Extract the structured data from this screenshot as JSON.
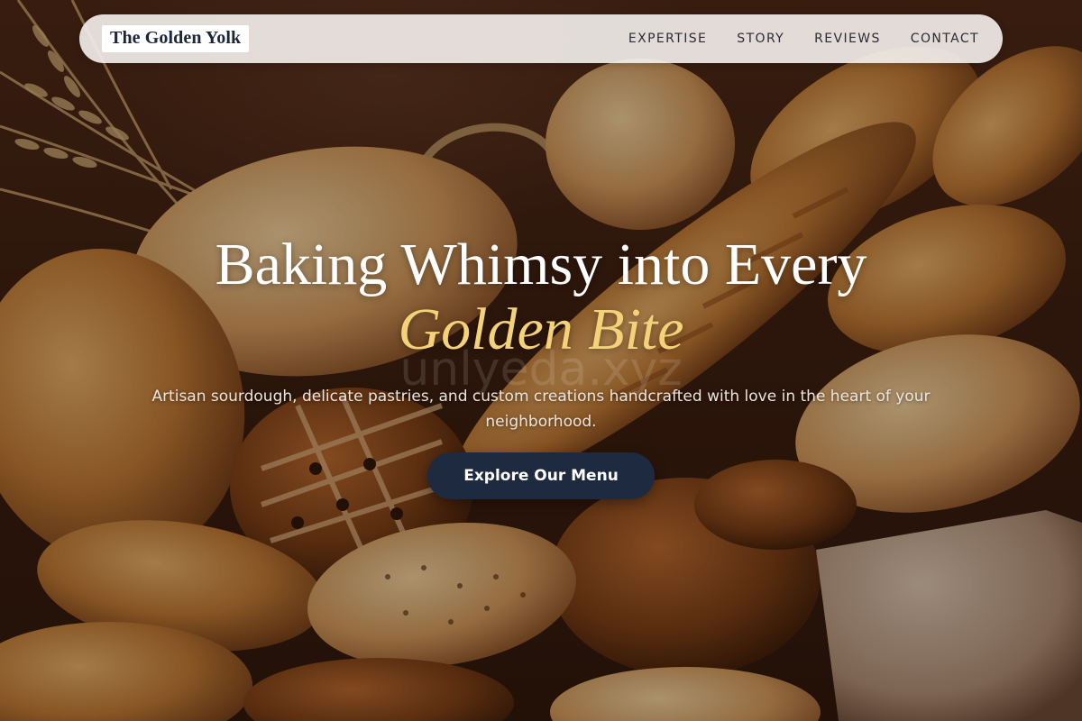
{
  "nav": {
    "brand": "The Golden Yolk",
    "links": [
      {
        "label": "EXPERTISE"
      },
      {
        "label": "STORY"
      },
      {
        "label": "REVIEWS"
      },
      {
        "label": "CONTACT"
      }
    ]
  },
  "hero": {
    "headline_line1": "Baking Whimsy into Every",
    "headline_accent": "Golden Bite",
    "subtitle": "Artisan sourdough, delicate pastries, and custom creations handcrafted with love in the heart of your neighborhood.",
    "cta_label": "Explore Our Menu",
    "watermark": "unlyeda.xyz"
  },
  "colors": {
    "accent_gold": "#f4d27a",
    "button_navy": "#1e2a40",
    "brand_text": "#1c2638"
  }
}
